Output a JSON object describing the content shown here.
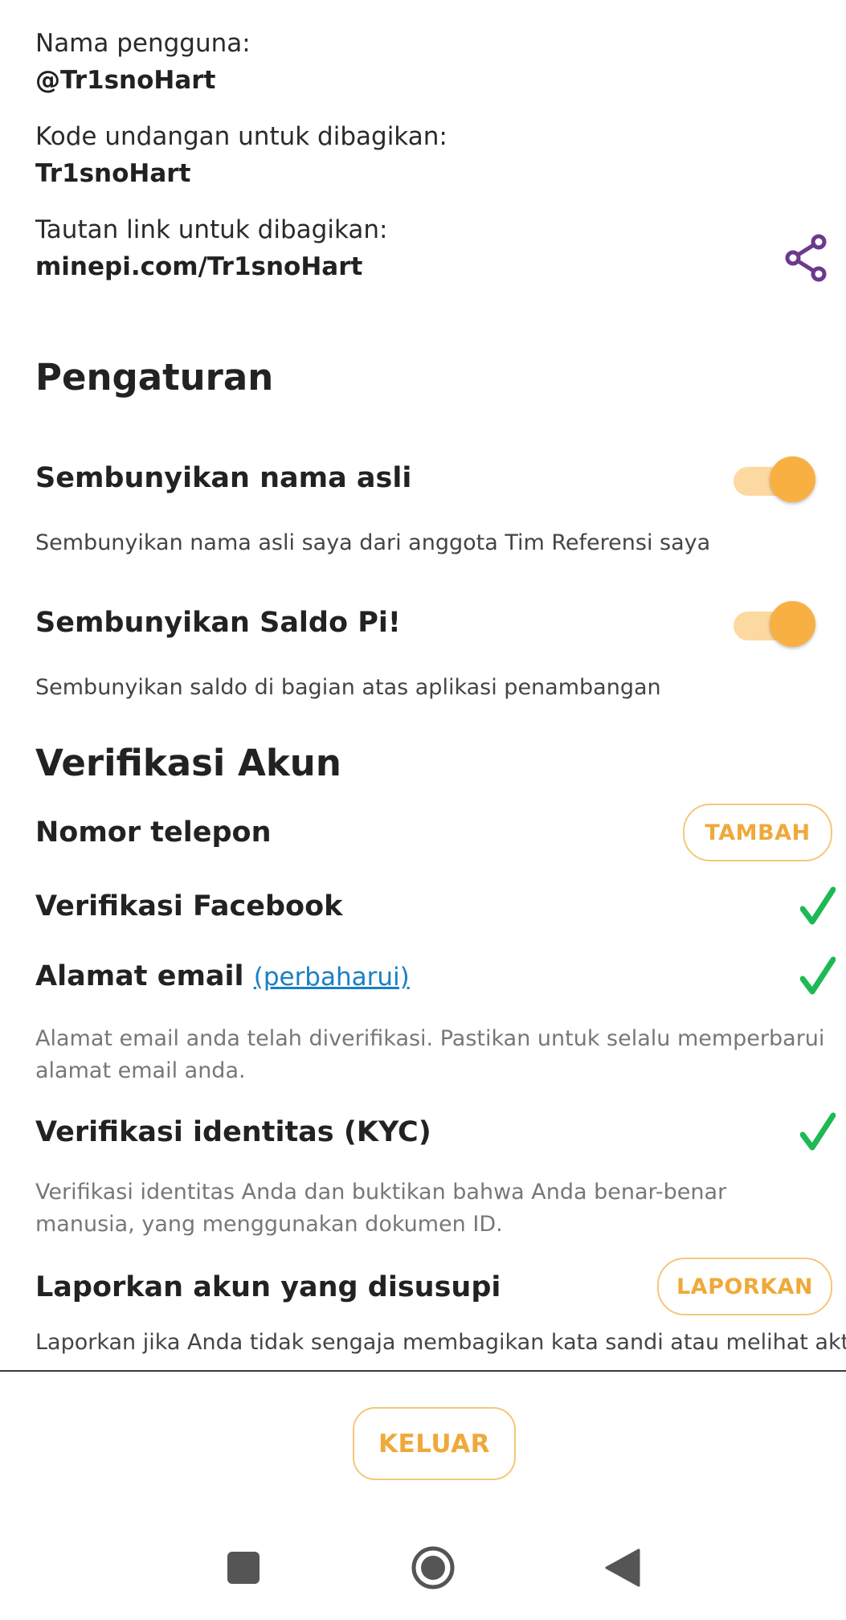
{
  "profile": {
    "username_label": "Nama pengguna:",
    "username_value": "@Tr1snoHart",
    "invite_label": "Kode undangan untuk dibagikan:",
    "invite_value": "Tr1snoHart",
    "link_label": "Tautan link untuk dibagikan:",
    "link_value": "minepi.com/Tr1snoHart",
    "share_icon": "share-icon"
  },
  "settings": {
    "title": "Pengaturan",
    "hide_name": {
      "title": "Sembunyikan nama asli",
      "description": "Sembunyikan nama asli saya dari anggota Tim Referensi saya",
      "enabled": true
    },
    "hide_balance": {
      "title": "Sembunyikan Saldo Pi!",
      "description": "Sembunyikan saldo di bagian atas aplikasi penambangan",
      "enabled": true
    }
  },
  "verification": {
    "title": "Verifikasi Akun",
    "phone": {
      "label": "Nomor telepon",
      "button": "TAMBAH"
    },
    "facebook": {
      "label": "Verifikasi Facebook",
      "verified": true
    },
    "email": {
      "label": "Alamat email",
      "update_link": "(perbaharui)",
      "verified": true,
      "description": "Alamat email anda telah diverifikasi. Pastikan untuk selalu memperbarui alamat email anda."
    },
    "kyc": {
      "label": "Verifikasi identitas (KYC)",
      "verified": true,
      "description": "Verifikasi identitas Anda dan buktikan bahwa Anda benar-benar manusia, yang menggunakan dokumen ID."
    },
    "report": {
      "label": "Laporkan akun yang disusupi",
      "button": "LAPORKAN",
      "description": "Laporkan jika Anda tidak sengaja membagikan kata sandi atau melihat aktivitas"
    }
  },
  "footer": {
    "logout_button": "KELUAR"
  },
  "colors": {
    "accent_orange": "#f9b042",
    "toggle_track": "#fcd9a0",
    "check_green": "#1db954",
    "share_purple": "#6b3a8c",
    "link_blue": "#1a7fc4"
  }
}
